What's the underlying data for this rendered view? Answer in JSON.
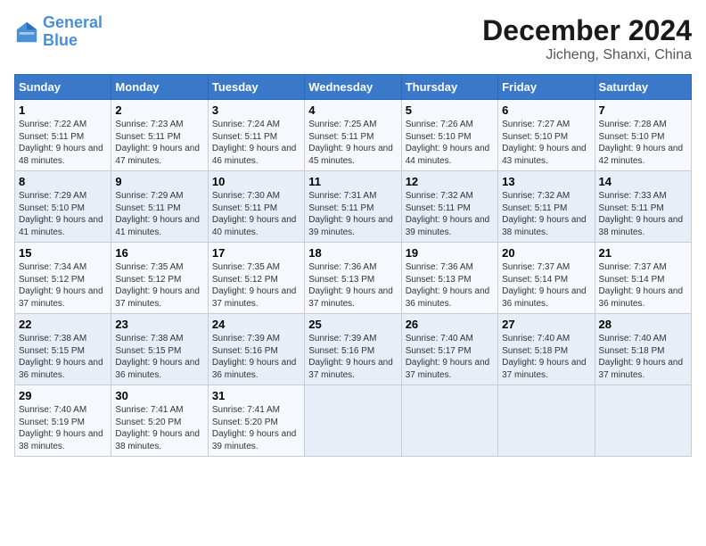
{
  "header": {
    "logo_line1": "General",
    "logo_line2": "Blue",
    "month_title": "December 2024",
    "location": "Jicheng, Shanxi, China"
  },
  "weekdays": [
    "Sunday",
    "Monday",
    "Tuesday",
    "Wednesday",
    "Thursday",
    "Friday",
    "Saturday"
  ],
  "weeks": [
    [
      {
        "day": "1",
        "sunrise": "7:22 AM",
        "sunset": "5:11 PM",
        "daylight": "9 hours and 48 minutes."
      },
      {
        "day": "2",
        "sunrise": "7:23 AM",
        "sunset": "5:11 PM",
        "daylight": "9 hours and 47 minutes."
      },
      {
        "day": "3",
        "sunrise": "7:24 AM",
        "sunset": "5:11 PM",
        "daylight": "9 hours and 46 minutes."
      },
      {
        "day": "4",
        "sunrise": "7:25 AM",
        "sunset": "5:11 PM",
        "daylight": "9 hours and 45 minutes."
      },
      {
        "day": "5",
        "sunrise": "7:26 AM",
        "sunset": "5:10 PM",
        "daylight": "9 hours and 44 minutes."
      },
      {
        "day": "6",
        "sunrise": "7:27 AM",
        "sunset": "5:10 PM",
        "daylight": "9 hours and 43 minutes."
      },
      {
        "day": "7",
        "sunrise": "7:28 AM",
        "sunset": "5:10 PM",
        "daylight": "9 hours and 42 minutes."
      }
    ],
    [
      {
        "day": "8",
        "sunrise": "7:29 AM",
        "sunset": "5:10 PM",
        "daylight": "9 hours and 41 minutes."
      },
      {
        "day": "9",
        "sunrise": "7:29 AM",
        "sunset": "5:11 PM",
        "daylight": "9 hours and 41 minutes."
      },
      {
        "day": "10",
        "sunrise": "7:30 AM",
        "sunset": "5:11 PM",
        "daylight": "9 hours and 40 minutes."
      },
      {
        "day": "11",
        "sunrise": "7:31 AM",
        "sunset": "5:11 PM",
        "daylight": "9 hours and 39 minutes."
      },
      {
        "day": "12",
        "sunrise": "7:32 AM",
        "sunset": "5:11 PM",
        "daylight": "9 hours and 39 minutes."
      },
      {
        "day": "13",
        "sunrise": "7:32 AM",
        "sunset": "5:11 PM",
        "daylight": "9 hours and 38 minutes."
      },
      {
        "day": "14",
        "sunrise": "7:33 AM",
        "sunset": "5:11 PM",
        "daylight": "9 hours and 38 minutes."
      }
    ],
    [
      {
        "day": "15",
        "sunrise": "7:34 AM",
        "sunset": "5:12 PM",
        "daylight": "9 hours and 37 minutes."
      },
      {
        "day": "16",
        "sunrise": "7:35 AM",
        "sunset": "5:12 PM",
        "daylight": "9 hours and 37 minutes."
      },
      {
        "day": "17",
        "sunrise": "7:35 AM",
        "sunset": "5:12 PM",
        "daylight": "9 hours and 37 minutes."
      },
      {
        "day": "18",
        "sunrise": "7:36 AM",
        "sunset": "5:13 PM",
        "daylight": "9 hours and 37 minutes."
      },
      {
        "day": "19",
        "sunrise": "7:36 AM",
        "sunset": "5:13 PM",
        "daylight": "9 hours and 36 minutes."
      },
      {
        "day": "20",
        "sunrise": "7:37 AM",
        "sunset": "5:14 PM",
        "daylight": "9 hours and 36 minutes."
      },
      {
        "day": "21",
        "sunrise": "7:37 AM",
        "sunset": "5:14 PM",
        "daylight": "9 hours and 36 minutes."
      }
    ],
    [
      {
        "day": "22",
        "sunrise": "7:38 AM",
        "sunset": "5:15 PM",
        "daylight": "9 hours and 36 minutes."
      },
      {
        "day": "23",
        "sunrise": "7:38 AM",
        "sunset": "5:15 PM",
        "daylight": "9 hours and 36 minutes."
      },
      {
        "day": "24",
        "sunrise": "7:39 AM",
        "sunset": "5:16 PM",
        "daylight": "9 hours and 36 minutes."
      },
      {
        "day": "25",
        "sunrise": "7:39 AM",
        "sunset": "5:16 PM",
        "daylight": "9 hours and 37 minutes."
      },
      {
        "day": "26",
        "sunrise": "7:40 AM",
        "sunset": "5:17 PM",
        "daylight": "9 hours and 37 minutes."
      },
      {
        "day": "27",
        "sunrise": "7:40 AM",
        "sunset": "5:18 PM",
        "daylight": "9 hours and 37 minutes."
      },
      {
        "day": "28",
        "sunrise": "7:40 AM",
        "sunset": "5:18 PM",
        "daylight": "9 hours and 37 minutes."
      }
    ],
    [
      {
        "day": "29",
        "sunrise": "7:40 AM",
        "sunset": "5:19 PM",
        "daylight": "9 hours and 38 minutes."
      },
      {
        "day": "30",
        "sunrise": "7:41 AM",
        "sunset": "5:20 PM",
        "daylight": "9 hours and 38 minutes."
      },
      {
        "day": "31",
        "sunrise": "7:41 AM",
        "sunset": "5:20 PM",
        "daylight": "9 hours and 39 minutes."
      },
      null,
      null,
      null,
      null
    ]
  ]
}
